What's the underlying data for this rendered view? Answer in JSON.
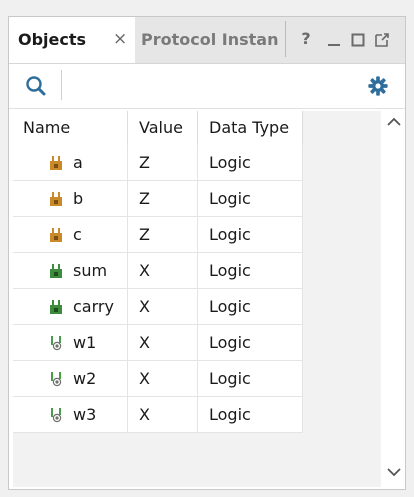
{
  "tabs": {
    "active": {
      "label": "Objects",
      "close_glyph": "×"
    },
    "inactive": {
      "label": "Protocol Instan"
    }
  },
  "window_controls": {
    "help_glyph": "?"
  },
  "icons": {
    "search": "search-icon",
    "settings": "gear-icon"
  },
  "table": {
    "headers": {
      "name": "Name",
      "value": "Value",
      "type": "Data Type"
    },
    "rows": [
      {
        "name": "a",
        "value": "Z",
        "type": "Logic",
        "kind": "input"
      },
      {
        "name": "b",
        "value": "Z",
        "type": "Logic",
        "kind": "input"
      },
      {
        "name": "c",
        "value": "Z",
        "type": "Logic",
        "kind": "input"
      },
      {
        "name": "sum",
        "value": "X",
        "type": "Logic",
        "kind": "output"
      },
      {
        "name": "carry",
        "value": "X",
        "type": "Logic",
        "kind": "output"
      },
      {
        "name": "w1",
        "value": "X",
        "type": "Logic",
        "kind": "wire"
      },
      {
        "name": "w2",
        "value": "X",
        "type": "Logic",
        "kind": "wire"
      },
      {
        "name": "w3",
        "value": "X",
        "type": "Logic",
        "kind": "wire"
      }
    ]
  },
  "colors": {
    "input_icon": "#c88a2a",
    "output_icon": "#3d8b3d",
    "wire_icon": "#4a9b4a",
    "accent_icon": "#2f6e9c"
  }
}
